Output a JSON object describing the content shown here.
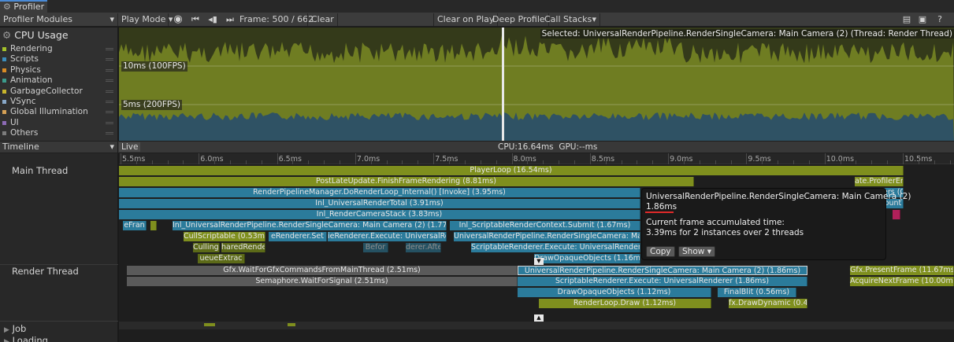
{
  "window": {
    "tab_title": "Profiler"
  },
  "toolbar": {
    "modules_label": "Profiler Modules",
    "play_mode_label": "Play Mode",
    "frame_label": "Frame: 500 / 662",
    "clear_label": "Clear",
    "clear_on_play_label": "Clear on Play",
    "deep_profile_label": "Deep Profile",
    "call_stacks_label": "Call Stacks"
  },
  "cpu_module": {
    "title": "CPU Usage",
    "legend": [
      {
        "label": "Rendering",
        "color": "#a4c12a"
      },
      {
        "label": "Scripts",
        "color": "#3c8dbb"
      },
      {
        "label": "Physics",
        "color": "#d98c25"
      },
      {
        "label": "Animation",
        "color": "#3c9c8c"
      },
      {
        "label": "GarbageCollector",
        "color": "#c8b52c"
      },
      {
        "label": "VSync",
        "color": "#88a8c8"
      },
      {
        "label": "Global Illumination",
        "color": "#d4a055"
      },
      {
        "label": "UI",
        "color": "#8c6ab5"
      },
      {
        "label": "Others",
        "color": "#7c7c7c"
      }
    ],
    "guide_10ms": "10ms (100FPS)",
    "guide_5ms": "5ms (200FPS)",
    "selected_text": "Selected: UniversalRenderPipeline.RenderSingleCamera: Main Camera (2) (Thread: Render Thread)"
  },
  "timeline_bar": {
    "view_label": "Timeline",
    "live_label": "Live",
    "cpu_text": "CPU:16.64ms",
    "gpu_text": "GPU:--ms"
  },
  "ruler": [
    "5.5ms",
    "6.0ms",
    "6.5ms",
    "7.0ms",
    "7.5ms",
    "8.0ms",
    "8.5ms",
    "9.0ms",
    "9.5ms",
    "10.0ms",
    "10.5ms"
  ],
  "threads": {
    "main": "Main Thread",
    "render": "Render Thread",
    "job": "Job",
    "loading": "Loading"
  },
  "main_blocks": {
    "b1": "PlayerLoop (16.54ms)",
    "b2": "PostLateUpdate.FinishFrameRendering (8.81ms)",
    "b2b": "ate.ProfilerEndFra",
    "b3": "RenderPipelineManager.DoRenderLoop_Internal() [Invoke] (3.95ms)",
    "b3b": "ers (0",
    "b4": "Inl_UniversalRenderTotal (3.91ms)",
    "b4b": "ount",
    "b5": "Inl_RenderCameraStack (3.83ms)",
    "b6a": "eFran",
    "b6b": "Inl_UniversalRenderPipeline.RenderSingleCamera: Main Camera (2) (1.77ms)",
    "b6c": "Inl_ScriptableRenderContext.Submit (1.67ms)",
    "b7a": "CullScriptable (0.53ms)",
    "b7b": "eRenderer.Set",
    "b7c": "ieRenderer.Execute: UniversalRender",
    "b7d": "UniversalRenderPipeline.RenderSingleCamera: Main Camera",
    "b8a": "Culling (S",
    "b8b": "haredRender",
    "b8c": "Befor",
    "b8d": "derer.Afte",
    "b8e": "ScriptableRenderer.Execute: UniversalRenderer",
    "b9a": "ueueExtrac",
    "b9b": "DrawOpaqueObjects (1.16ms)"
  },
  "render_blocks": {
    "r1": "Gfx.WaitForGfxCommandsFromMainThread (2.51ms)",
    "r1b": "UniversalRenderPipeline.RenderSingleCamera: Main Camera (2) (1.86ms)",
    "r1c": "Gfx.PresentFrame (11.67ms)",
    "r2": "Semaphore.WaitForSignal (2.51ms)",
    "r2b": "ScriptableRenderer.Execute: UniversalRenderer (1.86ms)",
    "r2c": "AcquireNextFrame (10.00ms)",
    "r3": "DrawOpaqueObjects (1.12ms)",
    "r3b": "FinalBlit (0.56ms)",
    "r4": "RenderLoop.Draw (1.12ms)",
    "r4b": "fx.DrawDynamic (0.49m"
  },
  "tooltip": {
    "title": "UniversalRenderPipeline.RenderSingleCamera: Main Camera (2)",
    "duration": "1.86ms",
    "accum_label": "Current frame accumulated time:",
    "accum_value": "3.39ms for 2 instances over 2 threads",
    "copy_label": "Copy",
    "show_label": "Show"
  },
  "colors": {
    "accent": "#4a8ad6",
    "rendering": "#7f8f1e",
    "scripts": "#2b7b9b",
    "highlight_underline": "#e02a2a"
  }
}
